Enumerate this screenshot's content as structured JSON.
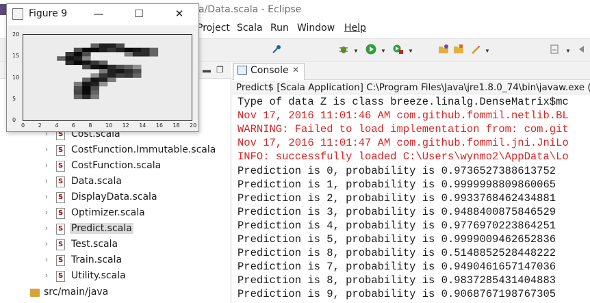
{
  "window": {
    "title": "a/Data.scala - Eclipse"
  },
  "menu": {
    "items": [
      "Project",
      "Scala",
      "Run",
      "Window",
      "Help"
    ]
  },
  "toolbar": {
    "icons": [
      "pin-icon",
      "debug-icon",
      "run-icon",
      "run-external-icon",
      "open-folder-icon",
      "open-type-icon",
      "edit-icon",
      "navigate-icon"
    ]
  },
  "project_explorer": {
    "files": [
      {
        "label": "Cost.scala",
        "selected": false
      },
      {
        "label": "CostFunction.Immutable.scala",
        "selected": false
      },
      {
        "label": "CostFunction.scala",
        "selected": false
      },
      {
        "label": "Data.scala",
        "selected": false
      },
      {
        "label": "DisplayData.scala",
        "selected": false
      },
      {
        "label": "Optimizer.scala",
        "selected": false
      },
      {
        "label": "Predict.scala",
        "selected": true
      },
      {
        "label": "Test.scala",
        "selected": false
      },
      {
        "label": "Train.scala",
        "selected": false
      },
      {
        "label": "Utility.scala",
        "selected": false
      }
    ],
    "source_folder": "src/main/java"
  },
  "console": {
    "tab_label": "Console",
    "close_glyph": "✕",
    "description": "Predict$ [Scala Application] C:\\Program Files\\Java\\jre1.8.0_74\\bin\\javaw.exe (1",
    "lines": [
      {
        "text": "Type of data Z is class breeze.linalg.DenseMatrix$mc",
        "color": "black"
      },
      {
        "text": "Nov 17, 2016 11:01:46 AM com.github.fommil.netlib.BL",
        "color": "red"
      },
      {
        "text": "WARNING: Failed to load implementation from: com.git",
        "color": "red"
      },
      {
        "text": "Nov 17, 2016 11:01:47 AM com.github.fommil.jni.JniLo",
        "color": "red"
      },
      {
        "text": "INFO: successfully loaded C:\\Users\\wynmo2\\AppData\\Lo",
        "color": "red"
      },
      {
        "text": "Prediction is 0, probability is 0.9736527388613752",
        "color": "black"
      },
      {
        "text": "Prediction is 1, probability is 0.9999998809860065",
        "color": "black"
      },
      {
        "text": "Prediction is 2, probability is 0.9933768462434881",
        "color": "black"
      },
      {
        "text": "Prediction is 3, probability is 0.9488400875846529",
        "color": "black"
      },
      {
        "text": "Prediction is 4, probability is 0.9776970223864251",
        "color": "black"
      },
      {
        "text": "Prediction is 5, probability is 0.9999009462652836",
        "color": "black"
      },
      {
        "text": "Prediction is 8, probability is 0.5148852528448222",
        "color": "black"
      },
      {
        "text": "Prediction is 7, probability is 0.9490461657147036",
        "color": "black"
      },
      {
        "text": "Prediction is 8, probability is 0.9837285431404883",
        "color": "black"
      },
      {
        "text": "Prediction is 9, probability is 0.9068767198767305",
        "color": "black"
      }
    ]
  },
  "figure": {
    "title": "Figure 9",
    "minimize_glyph": "—",
    "maximize_glyph": "☐",
    "close_glyph": "✕",
    "x_ticks": [
      "0",
      "2",
      "4",
      "6",
      "8",
      "10",
      "12",
      "14",
      "16",
      "18",
      "20"
    ],
    "y_ticks": [
      "20",
      "15",
      "10",
      "5",
      "0"
    ]
  },
  "chart_data": {
    "type": "heatmap",
    "xlim": [
      0,
      20
    ],
    "ylim": [
      0,
      20
    ],
    "grid": false,
    "colormap": "gray_r",
    "cells": [
      [
        8,
        17,
        0.6
      ],
      [
        9,
        17,
        0.9
      ],
      [
        10,
        17,
        0.9
      ],
      [
        11,
        17,
        0.7
      ],
      [
        6,
        16,
        0.7
      ],
      [
        7,
        16,
        1.0
      ],
      [
        8,
        16,
        1.0
      ],
      [
        9,
        16,
        0.9
      ],
      [
        10,
        16,
        0.8
      ],
      [
        11,
        16,
        0.9
      ],
      [
        12,
        16,
        1.0
      ],
      [
        13,
        16,
        0.95
      ],
      [
        14,
        16,
        0.85
      ],
      [
        15,
        16,
        0.6
      ],
      [
        5,
        15,
        0.8
      ],
      [
        6,
        15,
        1.0
      ],
      [
        7,
        15,
        0.7
      ],
      [
        12,
        15,
        0.5
      ],
      [
        13,
        15,
        0.85
      ],
      [
        14,
        15,
        0.85
      ],
      [
        15,
        15,
        0.6
      ],
      [
        4,
        14,
        0.6
      ],
      [
        5,
        14,
        0.95
      ],
      [
        6,
        14,
        0.9
      ],
      [
        7,
        14,
        0.45
      ],
      [
        5,
        13,
        0.85
      ],
      [
        6,
        13,
        1.0
      ],
      [
        7,
        13,
        0.95
      ],
      [
        8,
        13,
        0.8
      ],
      [
        9,
        13,
        0.6
      ],
      [
        7,
        12,
        0.7
      ],
      [
        8,
        12,
        0.95
      ],
      [
        9,
        12,
        1.0
      ],
      [
        10,
        12,
        0.85
      ],
      [
        11,
        12,
        0.7
      ],
      [
        12,
        12,
        0.6
      ],
      [
        13,
        12,
        0.4
      ],
      [
        9,
        11,
        0.5
      ],
      [
        10,
        11,
        0.9
      ],
      [
        11,
        11,
        0.95
      ],
      [
        12,
        11,
        0.85
      ],
      [
        13,
        11,
        0.7
      ],
      [
        8,
        10,
        0.4
      ],
      [
        9,
        10,
        0.8
      ],
      [
        10,
        10,
        0.9
      ],
      [
        11,
        10,
        0.75
      ],
      [
        12,
        10,
        0.8
      ],
      [
        13,
        10,
        0.6
      ],
      [
        7,
        9,
        0.6
      ],
      [
        8,
        9,
        0.95
      ],
      [
        9,
        9,
        0.9
      ],
      [
        10,
        9,
        0.5
      ],
      [
        6,
        8,
        0.5
      ],
      [
        7,
        8,
        0.95
      ],
      [
        8,
        8,
        0.9
      ],
      [
        9,
        8,
        0.4
      ],
      [
        6,
        7,
        0.7
      ],
      [
        7,
        7,
        1.0
      ],
      [
        8,
        7,
        0.7
      ],
      [
        6,
        6,
        0.75
      ],
      [
        7,
        6,
        1.0
      ],
      [
        8,
        6,
        0.6
      ],
      [
        6,
        5,
        0.6
      ],
      [
        7,
        5,
        0.85
      ],
      [
        8,
        5,
        0.5
      ]
    ]
  }
}
